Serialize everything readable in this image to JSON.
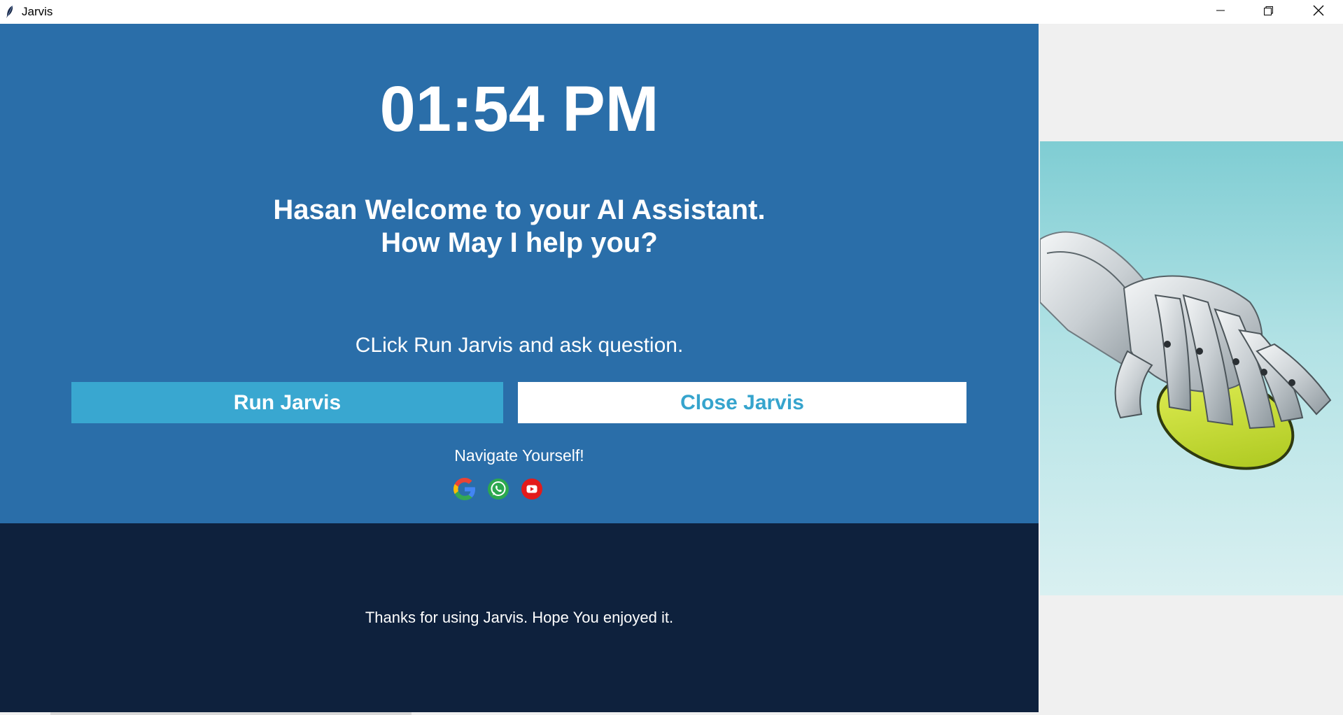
{
  "window": {
    "title": "Jarvis",
    "icons": [
      "feather-icon",
      "minimize-icon",
      "maximize-icon",
      "close-icon"
    ]
  },
  "main": {
    "clock": "01:54 PM",
    "welcome_line1": "Hasan Welcome to your AI Assistant.",
    "welcome_line2": "How May I help you?",
    "instruction": "CLick Run Jarvis and ask question.",
    "run_button": "Run Jarvis",
    "close_button": "Close Jarvis",
    "navigate_label": "Navigate Yourself!",
    "nav_icons": [
      "google-icon",
      "whatsapp-icon",
      "youtube-icon"
    ]
  },
  "footer": {
    "text": "Thanks for using Jarvis. Hope You enjoyed it."
  },
  "side": {
    "image": "robot-hand-on-mouse-image"
  },
  "colors": {
    "main_bg": "#2a6ea9",
    "footer_bg": "#0e213d",
    "run_button_bg": "#39a7d0",
    "close_button_text": "#36a4cd",
    "side_bg": "#f0f0f0"
  }
}
